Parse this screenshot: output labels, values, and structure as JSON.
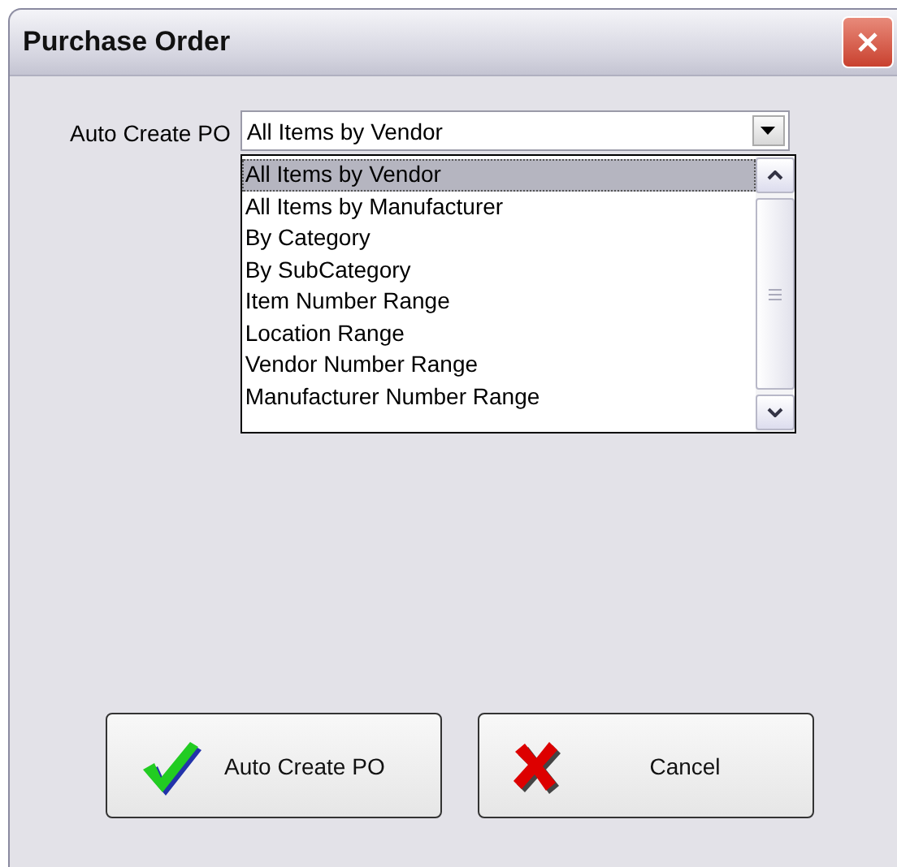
{
  "window": {
    "title": "Purchase Order"
  },
  "auto_create": {
    "label": "Auto Create PO",
    "value": "All Items by Vendor",
    "expanded": true,
    "options": [
      {
        "label": "All Items by Vendor",
        "selected": true
      },
      {
        "label": "All Items by Manufacturer",
        "selected": false
      },
      {
        "label": "By Category",
        "selected": false
      },
      {
        "label": "By SubCategory",
        "selected": false
      },
      {
        "label": "Item Number Range",
        "selected": false
      },
      {
        "label": "Location Range",
        "selected": false
      },
      {
        "label": "Vendor Number Range",
        "selected": false
      },
      {
        "label": "Manufacturer Number Range",
        "selected": false
      }
    ]
  },
  "buttons": [
    {
      "label": "Auto Create PO",
      "kind": "ok"
    },
    {
      "label": "Cancel",
      "kind": "cancel"
    }
  ]
}
